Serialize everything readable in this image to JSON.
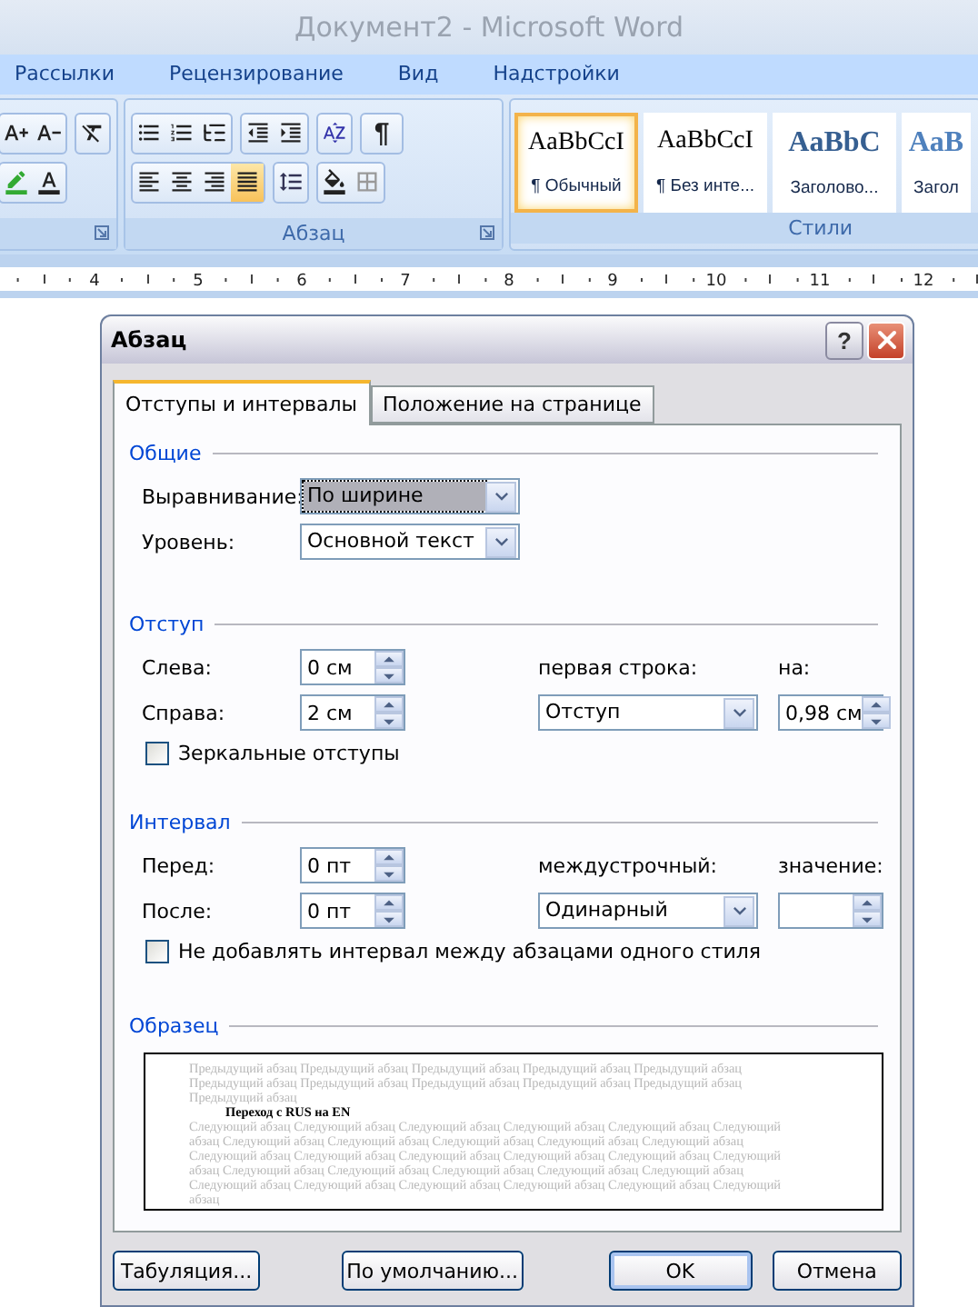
{
  "window": {
    "title": "Документ2 - Microsoft Word"
  },
  "ribbon": {
    "tabs": [
      {
        "label": "Рассылки"
      },
      {
        "label": "Рецензирование"
      },
      {
        "label": "Вид"
      },
      {
        "label": "Надстройки"
      }
    ],
    "paragraph_group": {
      "label": "Абзац",
      "show_marks": "¶",
      "alignment": [
        {
          "kind": "left",
          "selected": false
        },
        {
          "kind": "center",
          "selected": false
        },
        {
          "kind": "right",
          "selected": false
        },
        {
          "kind": "justify",
          "selected": true
        }
      ]
    },
    "styles_group": {
      "label": "Стили",
      "styles": [
        {
          "preview": "AaBbCcI",
          "name": "¶ Обычный",
          "kind": "normal",
          "selected": true
        },
        {
          "preview": "AaBbCcI",
          "name": "¶ Без инте...",
          "kind": "normal",
          "selected": false
        },
        {
          "preview": "AaBbC",
          "name": "Заголово...",
          "kind": "heading",
          "selected": false
        },
        {
          "preview": "AaB",
          "name": "Загол",
          "kind": "subheading",
          "selected": false
        }
      ]
    }
  },
  "ruler": {
    "numbers": [
      "4",
      "5",
      "6",
      "7",
      "8",
      "9",
      "10",
      "11",
      "12"
    ]
  },
  "dialog": {
    "title": "Абзац",
    "help_button": "?",
    "tabs": [
      {
        "label": "Отступы и интервалы",
        "selected": true
      },
      {
        "label": "Положение на странице",
        "selected": false
      }
    ],
    "general": {
      "label": "Общие",
      "alignment": {
        "label": "Выравнивание:",
        "value": "По ширине",
        "highlighted": true
      },
      "level": {
        "label": "Уровень:",
        "value": "Основной текст",
        "highlighted": false
      }
    },
    "indent": {
      "label": "Отступ",
      "left": {
        "label": "Слева:",
        "value": "0 см"
      },
      "right": {
        "label": "Справа:",
        "value": "2 см"
      },
      "first_line": {
        "label": "первая строка:",
        "value": "Отступ"
      },
      "by": {
        "label": "на:",
        "value": "0,98 см"
      },
      "mirror": {
        "label": "Зеркальные отступы",
        "checked": false
      }
    },
    "spacing": {
      "label": "Интервал",
      "before": {
        "label": "Перед:",
        "value": "0 пт"
      },
      "after": {
        "label": "После:",
        "value": "0 пт"
      },
      "line_spacing": {
        "label": "междустрочный:",
        "value": "Одинарный"
      },
      "amount": {
        "label": "значение:"
      },
      "dont_add": {
        "label": "Не добавлять интервал между абзацами одного стиля",
        "checked": false
      }
    },
    "preview": {
      "label": "Образец",
      "previous": "Предыдущий абзац Предыдущий абзац Предыдущий абзац Предыдущий абзац Предыдущий абзац Предыдущий абзац Предыдущий абзац Предыдущий абзац Предыдущий абзац Предыдущий абзац Предыдущий абзац",
      "current": "Переход с RUS на EN",
      "next": "Следующий абзац Следующий абзац Следующий абзац Следующий абзац Следующий абзац Следующий абзац Следующий абзац Следующий абзац Следующий абзац Следующий абзац Следующий абзац Следующий абзац Следующий абзац Следующий абзац Следующий абзац Следующий абзац Следующий абзац Следующий абзац Следующий абзац Следующий абзац Следующий абзац Следующий абзац Следующий абзац Следующий абзац Следующий абзац Следующий абзац Следующий абзац Следующий абзац"
    },
    "buttons": [
      {
        "label": "Табуляция...",
        "default": false
      },
      {
        "label": "По умолчанию...",
        "default": false
      },
      {
        "label": "OK",
        "default": true
      },
      {
        "label": "Отмена",
        "default": false
      }
    ]
  }
}
